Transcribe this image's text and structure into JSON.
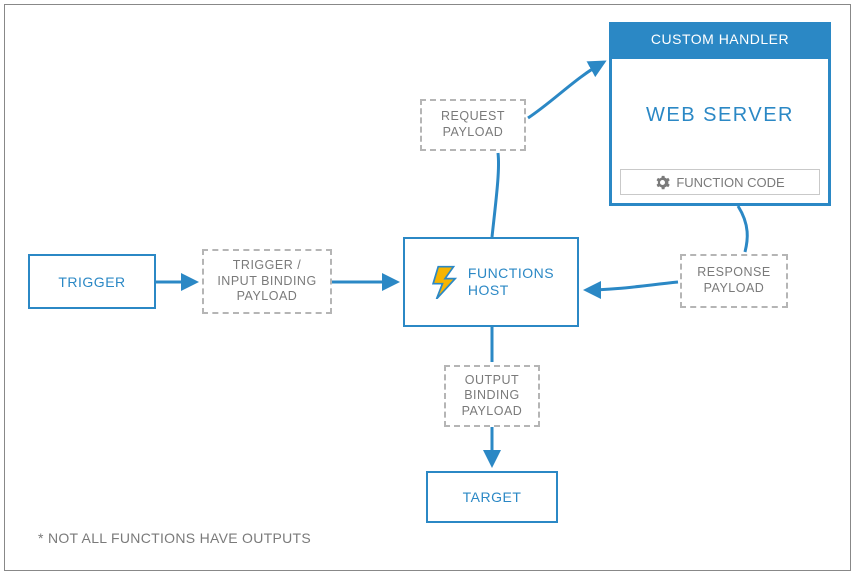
{
  "diagram": {
    "trigger": "TRIGGER",
    "input_payload": "TRIGGER /\nINPUT BINDING\nPAYLOAD",
    "functions_host": "FUNCTIONS\nHOST",
    "request_payload": "REQUEST\nPAYLOAD",
    "custom_handler_header": "CUSTOM HANDLER",
    "web_server": "WEB SERVER",
    "function_code": "FUNCTION CODE",
    "response_payload": "RESPONSE\nPAYLOAD",
    "output_payload": "OUTPUT\nBINDING\nPAYLOAD",
    "target": "TARGET",
    "footnote": "* NOT ALL FUNCTIONS HAVE OUTPUTS"
  },
  "icons": {
    "functions_bolt": "lightning-bolt-icon",
    "gear": "gear-icon"
  },
  "colors": {
    "blue": "#2b88c5",
    "dash_gray": "#b5b5b5",
    "text_gray": "#7a7a7a"
  }
}
